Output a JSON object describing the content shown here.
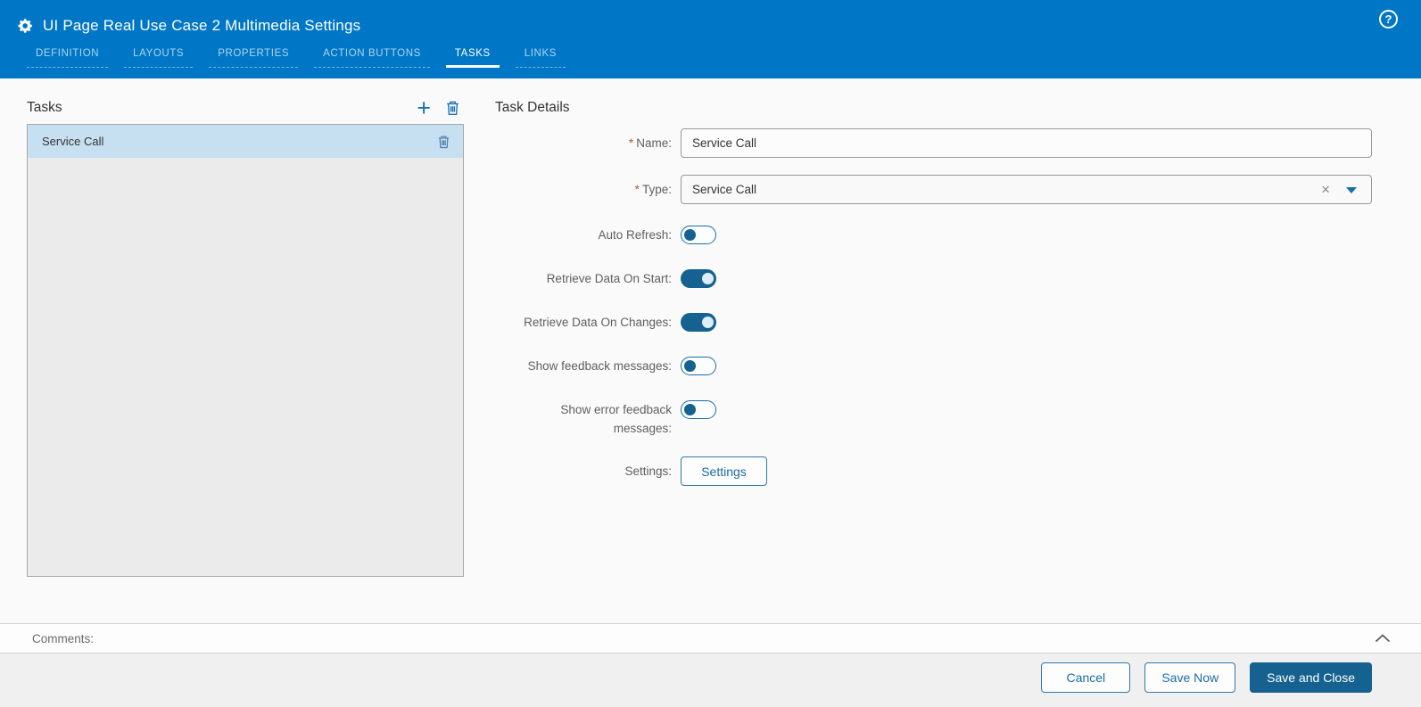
{
  "header": {
    "title": "UI Page Real Use Case 2 Multimedia Settings",
    "help_icon": "?",
    "tabs": [
      {
        "label": "DEFINITION",
        "active": false
      },
      {
        "label": "LAYOUTS",
        "active": false
      },
      {
        "label": "PROPERTIES",
        "active": false
      },
      {
        "label": "ACTION BUTTONS",
        "active": false
      },
      {
        "label": "TASKS",
        "active": true
      },
      {
        "label": "LINKS",
        "active": false
      }
    ]
  },
  "tasks_panel": {
    "title": "Tasks",
    "items": [
      {
        "label": "Service Call",
        "selected": true
      }
    ]
  },
  "task_details": {
    "title": "Task Details",
    "required_marker": "*",
    "fields": {
      "name": {
        "label": "Name:",
        "required": true,
        "value": "Service Call"
      },
      "type": {
        "label": "Type:",
        "required": true,
        "value": "Service Call",
        "clear_icon": "×"
      },
      "auto_refresh": {
        "label": "Auto Refresh:",
        "value": false
      },
      "retrieve_data_on_start": {
        "label": "Retrieve Data On Start:",
        "value": true
      },
      "retrieve_data_on_changes": {
        "label": "Retrieve Data On Changes:",
        "value": true
      },
      "show_feedback_messages": {
        "label": "Show feedback messages:",
        "value": false
      },
      "show_error_feedback_messages": {
        "label": "Show error feedback messages:",
        "value": false
      },
      "settings": {
        "label": "Settings:",
        "button_label": "Settings"
      }
    }
  },
  "comments": {
    "label": "Comments:"
  },
  "footer": {
    "buttons": [
      {
        "label": "Cancel",
        "style": "outline"
      },
      {
        "label": "Save Now",
        "style": "outline"
      },
      {
        "label": "Save and Close",
        "style": "primary"
      }
    ]
  },
  "colors": {
    "header_blue": "#0077c6",
    "accent_blue": "#1a73b5",
    "toggle_on_blue": "#15618f",
    "primary_button_blue": "#15618f",
    "selected_row_blue": "#c6dff1",
    "required_asterisk": "#a55c3e"
  }
}
